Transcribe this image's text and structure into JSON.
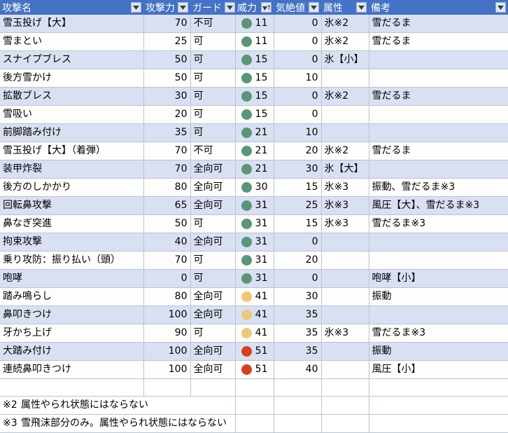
{
  "table": {
    "columns": [
      {
        "key": "name",
        "label": "攻撃名",
        "filter": "filter-dropdown-icon",
        "align": "left"
      },
      {
        "key": "attack",
        "label": "攻撃力",
        "filter": "filter-dropdown-icon",
        "align": "right"
      },
      {
        "key": "guard",
        "label": "ガード",
        "filter": "filter-dropdown-icon",
        "align": "left"
      },
      {
        "key": "power",
        "label": "威力",
        "filter": "filter-sort-ascending-icon",
        "align": "right"
      },
      {
        "key": "stun",
        "label": "気絶値",
        "filter": "filter-dropdown-icon",
        "align": "right"
      },
      {
        "key": "element",
        "label": "属性",
        "filter": "filter-dropdown-icon",
        "align": "left"
      },
      {
        "key": "remarks",
        "label": "備考",
        "filter": "filter-dropdown-icon",
        "align": "left"
      }
    ],
    "colors": {
      "header_bg": "#4472c4",
      "header_text": "#ffffff",
      "band_row_bg": "#d9e0f2",
      "plain_row_bg": "#fdfdfb",
      "grid_line": "#b8c4da",
      "dot_green": "#5a9578",
      "dot_orange": "#eec878",
      "dot_red": "#d6401e"
    },
    "rows": [
      {
        "name": "雪玉投げ【大】",
        "attack": "70",
        "guard": "不可",
        "dot": "green",
        "power": "11",
        "stun": "0",
        "element": "氷※2",
        "remarks": "雪だるま"
      },
      {
        "name": "雪まとい",
        "attack": "25",
        "guard": "可",
        "dot": "green",
        "power": "11",
        "stun": "0",
        "element": "氷※2",
        "remarks": "雪だるま"
      },
      {
        "name": "スナイプブレス",
        "attack": "50",
        "guard": "可",
        "dot": "green",
        "power": "15",
        "stun": "0",
        "element": "氷【小】",
        "remarks": ""
      },
      {
        "name": "後方雪かけ",
        "attack": "50",
        "guard": "可",
        "dot": "green",
        "power": "15",
        "stun": "10",
        "element": "",
        "remarks": ""
      },
      {
        "name": "拡散ブレス",
        "attack": "30",
        "guard": "可",
        "dot": "green",
        "power": "15",
        "stun": "0",
        "element": "氷※2",
        "remarks": "雪だるま"
      },
      {
        "name": "雪吸い",
        "attack": "20",
        "guard": "可",
        "dot": "green",
        "power": "15",
        "stun": "0",
        "element": "",
        "remarks": ""
      },
      {
        "name": "前脚踏み付け",
        "attack": "35",
        "guard": "可",
        "dot": "green",
        "power": "21",
        "stun": "10",
        "element": "",
        "remarks": ""
      },
      {
        "name": "雪玉投げ【大】（着弾）",
        "attack": "70",
        "guard": "不可",
        "dot": "green",
        "power": "21",
        "stun": "20",
        "element": "氷※2",
        "remarks": "雪だるま"
      },
      {
        "name": "装甲炸裂",
        "attack": "70",
        "guard": "全向可",
        "dot": "green",
        "power": "21",
        "stun": "30",
        "element": "氷【大】",
        "remarks": ""
      },
      {
        "name": "後方のしかかり",
        "attack": "80",
        "guard": "全向可",
        "dot": "green",
        "power": "30",
        "stun": "15",
        "element": "氷※3",
        "remarks": "振動、雪だるま※3"
      },
      {
        "name": "回転鼻攻撃",
        "attack": "65",
        "guard": "全向可",
        "dot": "green",
        "power": "31",
        "stun": "25",
        "element": "氷※3",
        "remarks": "風圧【大】、雪だるま※3"
      },
      {
        "name": "鼻なぎ突進",
        "attack": "50",
        "guard": "可",
        "dot": "green",
        "power": "31",
        "stun": "15",
        "element": "氷※3",
        "remarks": "雪だるま※3"
      },
      {
        "name": "拘束攻撃",
        "attack": "40",
        "guard": "全向可",
        "dot": "green",
        "power": "31",
        "stun": "0",
        "element": "",
        "remarks": ""
      },
      {
        "name": "乗り攻防：振り払い（頭）",
        "attack": "70",
        "guard": "可",
        "dot": "green",
        "power": "31",
        "stun": "20",
        "element": "",
        "remarks": ""
      },
      {
        "name": "咆哮",
        "attack": "0",
        "guard": "可",
        "dot": "green",
        "power": "31",
        "stun": "0",
        "element": "",
        "remarks": "咆哮【小】"
      },
      {
        "name": "踏み鳴らし",
        "attack": "80",
        "guard": "全向可",
        "dot": "orange",
        "power": "41",
        "stun": "30",
        "element": "",
        "remarks": "振動"
      },
      {
        "name": "鼻叩きつけ",
        "attack": "100",
        "guard": "全向可",
        "dot": "orange",
        "power": "41",
        "stun": "35",
        "element": "",
        "remarks": ""
      },
      {
        "name": "牙かち上げ",
        "attack": "90",
        "guard": "可",
        "dot": "orange",
        "power": "41",
        "stun": "35",
        "element": "氷※3",
        "remarks": "雪だるま※3"
      },
      {
        "name": "大踏み付け",
        "attack": "100",
        "guard": "全向可",
        "dot": "red",
        "power": "51",
        "stun": "35",
        "element": "",
        "remarks": "振動"
      },
      {
        "name": "連続鼻叩きつけ",
        "attack": "100",
        "guard": "全向可",
        "dot": "red",
        "power": "51",
        "stun": "40",
        "element": "",
        "remarks": "風圧【小】"
      }
    ],
    "footnotes": [
      {
        "mark": "※2",
        "text": "属性やられ状態にはならない"
      },
      {
        "mark": "※3",
        "text": "雪飛沫部分のみ。属性やられ状態にはならない"
      }
    ]
  }
}
